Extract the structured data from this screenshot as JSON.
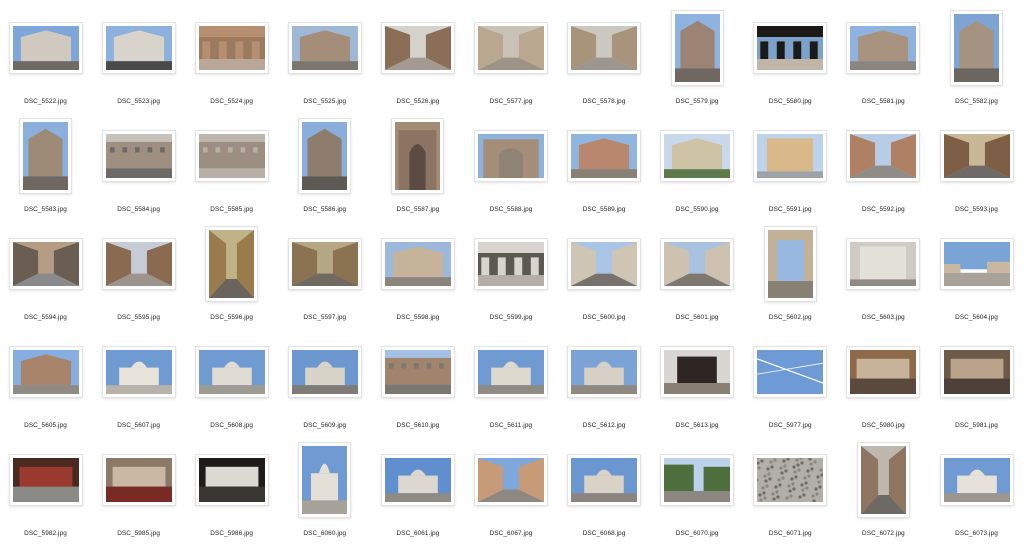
{
  "window": {
    "view": "icon-grid"
  },
  "files": [
    {
      "name": "DSC_5522.jpg",
      "orientation": "landscape",
      "scene": "sky-building",
      "colors": {
        "sky": "#7fa6d8",
        "main": "#cfc9c0",
        "ground": "#6e6a66"
      }
    },
    {
      "name": "DSC_5523.jpg",
      "orientation": "landscape",
      "scene": "sky-building",
      "colors": {
        "sky": "#8db1dd",
        "main": "#d8d3cb",
        "ground": "#4a4a4a"
      }
    },
    {
      "name": "DSC_5524.jpg",
      "orientation": "landscape",
      "scene": "arcade",
      "colors": {
        "sky": "#b58f6f",
        "main": "#9c7a5f",
        "ground": "#b9a897"
      }
    },
    {
      "name": "DSC_5525.jpg",
      "orientation": "landscape",
      "scene": "sky-building",
      "colors": {
        "sky": "#9fb8d6",
        "main": "#a58e79",
        "ground": "#7c7670"
      }
    },
    {
      "name": "DSC_5526.jpg",
      "orientation": "landscape",
      "scene": "street",
      "colors": {
        "sky": "#d5d2cc",
        "main": "#8b6e57",
        "ground": "#a39a91"
      }
    },
    {
      "name": "DSC_5577.jpg",
      "orientation": "landscape",
      "scene": "street",
      "colors": {
        "sky": "#c9c2b7",
        "main": "#b9a790",
        "ground": "#9d9387"
      }
    },
    {
      "name": "DSC_5578.jpg",
      "orientation": "landscape",
      "scene": "street",
      "colors": {
        "sky": "#cbc8c1",
        "main": "#a8937b",
        "ground": "#9c968e"
      }
    },
    {
      "name": "DSC_5579.jpg",
      "orientation": "portrait",
      "scene": "sky-building",
      "colors": {
        "sky": "#8eb3e0",
        "main": "#9c8474",
        "ground": "#6f6760"
      }
    },
    {
      "name": "DSC_5580.jpg",
      "orientation": "landscape",
      "scene": "arcade",
      "colors": {
        "sky": "#1c1a18",
        "main": "#7ea1c9",
        "ground": "#bfb6a8"
      }
    },
    {
      "name": "DSC_5581.jpg",
      "orientation": "landscape",
      "scene": "sky-building",
      "colors": {
        "sky": "#8eb3e0",
        "main": "#a89280",
        "ground": "#8b8580"
      }
    },
    {
      "name": "DSC_5582.jpg",
      "orientation": "portrait",
      "scene": "sky-building",
      "colors": {
        "sky": "#7ea4d4",
        "main": "#a59382",
        "ground": "#6c6660"
      }
    },
    {
      "name": "DSC_5583.jpg",
      "orientation": "portrait",
      "scene": "sky-building",
      "colors": {
        "sky": "#8cb0dd",
        "main": "#9d8a77",
        "ground": "#6f6861"
      }
    },
    {
      "name": "DSC_5584.jpg",
      "orientation": "landscape",
      "scene": "facade",
      "colors": {
        "sky": "#c7c3bc",
        "main": "#9f8f80",
        "ground": "#6c6a67"
      }
    },
    {
      "name": "DSC_5585.jpg",
      "orientation": "landscape",
      "scene": "facade",
      "colors": {
        "sky": "#bdb6ac",
        "main": "#9c8f82",
        "ground": "#b7b0a6"
      }
    },
    {
      "name": "DSC_5586.jpg",
      "orientation": "portrait",
      "scene": "sky-building",
      "colors": {
        "sky": "#8aaedb",
        "main": "#8e7c6c",
        "ground": "#5d5a56"
      }
    },
    {
      "name": "DSC_5587.jpg",
      "orientation": "portrait",
      "scene": "church-door",
      "colors": {
        "sky": "#a48b76",
        "main": "#8c7462",
        "ground": "#5a4c42"
      }
    },
    {
      "name": "DSC_5588.jpg",
      "orientation": "landscape",
      "scene": "church-door",
      "colors": {
        "sky": "#8fb2dc",
        "main": "#a58e79",
        "ground": "#8f8376"
      }
    },
    {
      "name": "DSC_5589.jpg",
      "orientation": "landscape",
      "scene": "sky-building",
      "colors": {
        "sky": "#90b6e0",
        "main": "#b9866e",
        "ground": "#8a7f74"
      }
    },
    {
      "name": "DSC_5590.jpg",
      "orientation": "landscape",
      "scene": "sky-building",
      "colors": {
        "sky": "#c9d8ea",
        "main": "#cfc3a5",
        "ground": "#5f7a4a"
      }
    },
    {
      "name": "DSC_5591.jpg",
      "orientation": "landscape",
      "scene": "wall",
      "colors": {
        "sky": "#bcd3ea",
        "main": "#d9b98a",
        "ground": "#9ca2a6"
      }
    },
    {
      "name": "DSC_5592.jpg",
      "orientation": "landscape",
      "scene": "street",
      "colors": {
        "sky": "#b7cde6",
        "main": "#b08064",
        "ground": "#8f8b86"
      }
    },
    {
      "name": "DSC_5593.jpg",
      "orientation": "landscape",
      "scene": "street",
      "colors": {
        "sky": "#c8b896",
        "main": "#7e5e44",
        "ground": "#6f6a66"
      }
    },
    {
      "name": "DSC_5594.jpg",
      "orientation": "landscape",
      "scene": "street",
      "colors": {
        "sky": "#b59d84",
        "main": "#6a5d52",
        "ground": "#8a8a8c"
      }
    },
    {
      "name": "DSC_5595.jpg",
      "orientation": "landscape",
      "scene": "street",
      "colors": {
        "sky": "#c5ccd6",
        "main": "#8a6a50",
        "ground": "#9c958e"
      }
    },
    {
      "name": "DSC_5596.jpg",
      "orientation": "portrait",
      "scene": "street",
      "colors": {
        "sky": "#c0b387",
        "main": "#9a7c4c",
        "ground": "#6a645c"
      }
    },
    {
      "name": "DSC_5597.jpg",
      "orientation": "landscape",
      "scene": "street",
      "colors": {
        "sky": "#b5a684",
        "main": "#8b7250",
        "ground": "#716a61"
      }
    },
    {
      "name": "DSC_5598.jpg",
      "orientation": "landscape",
      "scene": "sky-building",
      "colors": {
        "sky": "#9cb8dc",
        "main": "#c5b39a",
        "ground": "#8c857e"
      }
    },
    {
      "name": "DSC_5599.jpg",
      "orientation": "landscape",
      "scene": "arcade",
      "colors": {
        "sky": "#d8d4ce",
        "main": "#5d5853",
        "ground": "#b6aea4"
      }
    },
    {
      "name": "DSC_5600.jpg",
      "orientation": "landscape",
      "scene": "street",
      "colors": {
        "sky": "#a8c4e6",
        "main": "#cfc5b5",
        "ground": "#77726c"
      }
    },
    {
      "name": "DSC_5601.jpg",
      "orientation": "landscape",
      "scene": "street",
      "colors": {
        "sky": "#a8c2e0",
        "main": "#cdc2b0",
        "ground": "#7e7871"
      }
    },
    {
      "name": "DSC_5602.jpg",
      "orientation": "portrait",
      "scene": "arch-view",
      "colors": {
        "sky": "#98b8df",
        "main": "#c2b196",
        "ground": "#8a8175"
      }
    },
    {
      "name": "DSC_5603.jpg",
      "orientation": "landscape",
      "scene": "wall",
      "colors": {
        "sky": "#cfcac4",
        "main": "#e4e1db",
        "ground": "#8e8a84"
      }
    },
    {
      "name": "DSC_5604.jpg",
      "orientation": "landscape",
      "scene": "square",
      "colors": {
        "sky": "#7aa3d6",
        "main": "#c8b7a1",
        "ground": "#a8a29a"
      }
    },
    {
      "name": "DSC_5605.jpg",
      "orientation": "landscape",
      "scene": "sky-building",
      "colors": {
        "sky": "#86aee0",
        "main": "#a8846a",
        "ground": "#8f8a84"
      }
    },
    {
      "name": "DSC_5607.jpg",
      "orientation": "landscape",
      "scene": "dome",
      "colors": {
        "sky": "#6f9ad2",
        "main": "#e8e4dc",
        "ground": "#b7b2aa"
      }
    },
    {
      "name": "DSC_5608.jpg",
      "orientation": "landscape",
      "scene": "dome",
      "colors": {
        "sky": "#6f9ad2",
        "main": "#e0dcd4",
        "ground": "#9e9a94"
      }
    },
    {
      "name": "DSC_5609.jpg",
      "orientation": "landscape",
      "scene": "dome",
      "colors": {
        "sky": "#6c97cf",
        "main": "#d8d3c9",
        "ground": "#7f7b76"
      }
    },
    {
      "name": "DSC_5610.jpg",
      "orientation": "landscape",
      "scene": "facade",
      "colors": {
        "sky": "#a3c1e4",
        "main": "#a0846b",
        "ground": "#7d7770"
      }
    },
    {
      "name": "DSC_5611.jpg",
      "orientation": "landscape",
      "scene": "dome",
      "colors": {
        "sky": "#6f9ad2",
        "main": "#ded9cf",
        "ground": "#8e8a84"
      }
    },
    {
      "name": "DSC_5612.jpg",
      "orientation": "landscape",
      "scene": "dome",
      "colors": {
        "sky": "#7ca3d6",
        "main": "#d6d0c6",
        "ground": "#8e8880"
      }
    },
    {
      "name": "DSC_5613.jpg",
      "orientation": "landscape",
      "scene": "arch-view",
      "colors": {
        "sky": "#2d2622",
        "main": "#d8d6d3",
        "ground": "#8a7f73"
      }
    },
    {
      "name": "DSC_5977.jpg",
      "orientation": "landscape",
      "scene": "contrail",
      "colors": {
        "sky": "#6e9bd6",
        "main": "#ffffff",
        "ground": "#6e9bd6"
      }
    },
    {
      "name": "DSC_5980.jpg",
      "orientation": "landscape",
      "scene": "interior",
      "colors": {
        "sky": "#8e6a4a",
        "main": "#c7b39a",
        "ground": "#5a4a3e"
      }
    },
    {
      "name": "DSC_5981.jpg",
      "orientation": "landscape",
      "scene": "interior",
      "colors": {
        "sky": "#6e5a48",
        "main": "#b9a38a",
        "ground": "#4c4038"
      }
    },
    {
      "name": "DSC_5982.jpg",
      "orientation": "landscape",
      "scene": "interior",
      "colors": {
        "sky": "#4a2a20",
        "main": "#9a3a2e",
        "ground": "#8a8a86"
      }
    },
    {
      "name": "DSC_5985.jpg",
      "orientation": "landscape",
      "scene": "interior",
      "colors": {
        "sky": "#8c7a68",
        "main": "#c9b9a4",
        "ground": "#7a2a24"
      }
    },
    {
      "name": "DSC_5986.jpg",
      "orientation": "landscape",
      "scene": "interior",
      "colors": {
        "sky": "#1e1c1a",
        "main": "#dcd8d2",
        "ground": "#3a3633"
      }
    },
    {
      "name": "DSC_6060.jpg",
      "orientation": "portrait",
      "scene": "dome",
      "colors": {
        "sky": "#6f9ad2",
        "main": "#e4e0d8",
        "ground": "#a7a29a"
      }
    },
    {
      "name": "DSC_6061.jpg",
      "orientation": "landscape",
      "scene": "dome",
      "colors": {
        "sky": "#5f8fcf",
        "main": "#ddd8cf",
        "ground": "#8e8a84"
      }
    },
    {
      "name": "DSC_6067.jpg",
      "orientation": "landscape",
      "scene": "street",
      "colors": {
        "sky": "#7ea8dc",
        "main": "#c79b78",
        "ground": "#8e8881"
      }
    },
    {
      "name": "DSC_6068.jpg",
      "orientation": "landscape",
      "scene": "dome",
      "colors": {
        "sky": "#6b97d1",
        "main": "#d9d2c6",
        "ground": "#8a857f"
      }
    },
    {
      "name": "DSC_6070.jpg",
      "orientation": "landscape",
      "scene": "trees",
      "colors": {
        "sky": "#bcd2ea",
        "main": "#4f6e3e",
        "ground": "#8c8881"
      }
    },
    {
      "name": "DSC_6071.jpg",
      "orientation": "landscape",
      "scene": "cobble",
      "colors": {
        "sky": "#8a8884",
        "main": "#b2afaa",
        "ground": "#6e6c68"
      }
    },
    {
      "name": "DSC_6072.jpg",
      "orientation": "portrait",
      "scene": "street",
      "colors": {
        "sky": "#bfb8ae",
        "main": "#8e7560",
        "ground": "#6f6963"
      }
    },
    {
      "name": "DSC_6073.jpg",
      "orientation": "landscape",
      "scene": "dome",
      "colors": {
        "sky": "#6f9ad2",
        "main": "#e6e2da",
        "ground": "#9c9690"
      }
    }
  ]
}
